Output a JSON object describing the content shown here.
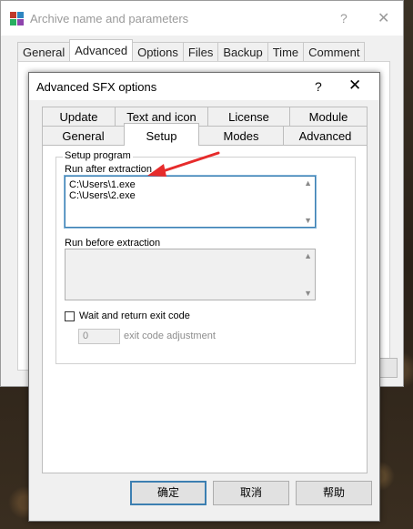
{
  "back_window": {
    "title": "Archive name and parameters",
    "help": "?",
    "close": "✕",
    "tabs": [
      "General",
      "Advanced",
      "Options",
      "Files",
      "Backup",
      "Time",
      "Comment"
    ],
    "active_tab": "Advanced"
  },
  "dialog": {
    "title": "Advanced SFX options",
    "help": "?",
    "close": "✕",
    "tabs_row1": [
      "Update",
      "Text and icon",
      "License",
      "Module"
    ],
    "tabs_row2": [
      "General",
      "Setup",
      "Modes",
      "Advanced"
    ],
    "active_tab": "Setup",
    "group_title": "Setup program",
    "run_after_label": "Run after extraction",
    "run_after_lines": [
      "C:\\Users\\1.exe",
      "C:\\Users\\2.exe"
    ],
    "run_before_label": "Run before extraction",
    "wait_checkbox_label": "Wait and return exit code",
    "wait_checked": false,
    "exit_code_value": "0",
    "exit_code_label": "exit code adjustment",
    "buttons": {
      "ok": "确定",
      "cancel": "取消",
      "help": "帮助"
    }
  },
  "colors": {
    "annotation_arrow": "#e62b2b",
    "focus_border": "#3c7fb1"
  },
  "icons": {
    "app": "winrar-icon",
    "scroll_up": "scroll-up-icon",
    "scroll_down": "scroll-down-icon",
    "arrow": "red-arrow-annotation"
  }
}
